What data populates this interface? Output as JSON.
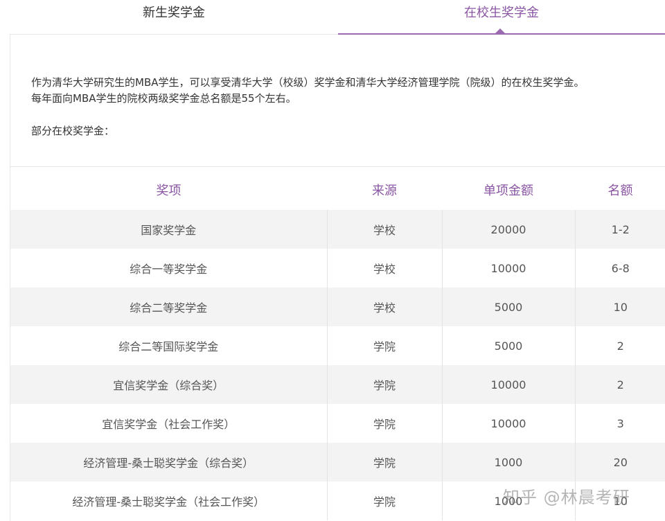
{
  "tabs": {
    "freshman": "新生奖学金",
    "current": "在校生奖学金"
  },
  "intro": {
    "line1": "作为清华大学研究生的MBA学生，可以享受清华大学（校级）奖学金和清华大学经济管理学院（院级）的在校生奖学金。",
    "line2": "每年面向MBA学生的院校两级奖学金总名额是55个左右。",
    "subheading": "部分在校奖学金："
  },
  "table": {
    "headers": [
      "奖项",
      "来源",
      "单项金额",
      "名额"
    ],
    "rows": [
      [
        "国家奖学金",
        "学校",
        "20000",
        "1-2"
      ],
      [
        "综合一等奖学金",
        "学校",
        "10000",
        "6-8"
      ],
      [
        "综合二等奖学金",
        "学校",
        "5000",
        "10"
      ],
      [
        "综合二等国际奖学金",
        "学院",
        "5000",
        "2"
      ],
      [
        "宜信奖学金（综合奖）",
        "学院",
        "10000",
        "2"
      ],
      [
        "宜信奖学金（社会工作奖）",
        "学院",
        "10000",
        "3"
      ],
      [
        "经济管理-桑士聪奖学金（综合奖）",
        "学院",
        "1000",
        "20"
      ],
      [
        "经济管理-桑士聪奖学金（社会工作奖）",
        "学院",
        "1000",
        "10"
      ]
    ]
  },
  "watermark": "知乎 @林晨考研",
  "colors": {
    "accent": "#8a55a3",
    "row_stripe": "#f3f3f3",
    "text": "#333333"
  }
}
